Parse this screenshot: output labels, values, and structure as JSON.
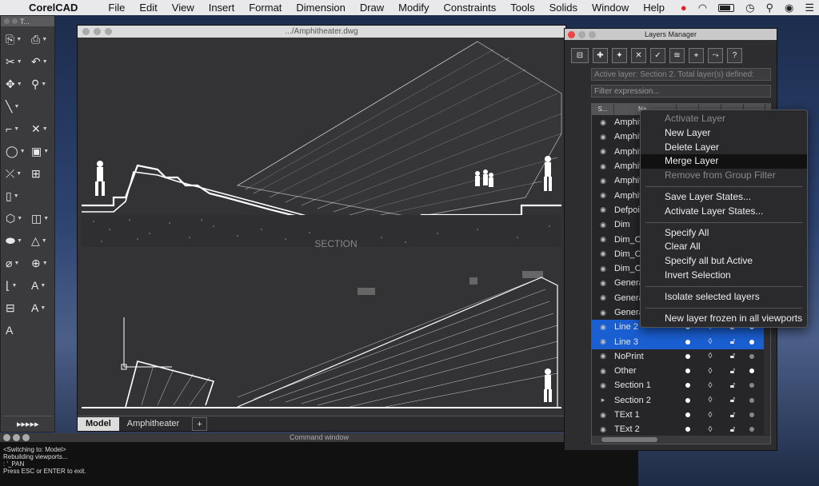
{
  "menubar": {
    "app_name": "CorelCAD",
    "items": [
      "File",
      "Edit",
      "View",
      "Insert",
      "Format",
      "Dimension",
      "Draw",
      "Modify",
      "Constraints",
      "Tools",
      "Solids",
      "Window",
      "Help"
    ]
  },
  "toolbox": {
    "title": "T...",
    "footer": "▸▸▸▸▸"
  },
  "drawing": {
    "title": ".../Amphitheater.dwg",
    "section_label": "SECTION",
    "tabs": [
      "Model",
      "Amphitheater",
      "+"
    ]
  },
  "command": {
    "title": "Command window",
    "lines": [
      "<Switching to: Model>",
      "Rebuilding viewports...",
      ": '_PAN",
      "Press ESC or ENTER to exit."
    ]
  },
  "layers": {
    "title": "Layers Manager",
    "active_text": "Active layer: Section 2. Total layer(s) defined:",
    "filter_placeholder": "Filter expression...",
    "headers": [
      "S...",
      "Na...",
      "",
      "",
      " ",
      ""
    ],
    "rows": [
      {
        "name": "Amphitheater"
      },
      {
        "name": "Amphitheater"
      },
      {
        "name": "Amphitheater"
      },
      {
        "name": "Amphitheater"
      },
      {
        "name": "Amphitheater"
      },
      {
        "name": "Amphitheater"
      },
      {
        "name": "Defpoints"
      },
      {
        "name": "Dim"
      },
      {
        "name": "Dim_Cont"
      },
      {
        "name": "Dim_Cont"
      },
      {
        "name": "Dim_Cont"
      },
      {
        "name": "General"
      },
      {
        "name": "General"
      },
      {
        "name": "General"
      },
      {
        "name": "Line 2"
      },
      {
        "name": "Line 3"
      },
      {
        "name": "NoPrint"
      },
      {
        "name": "Other"
      },
      {
        "name": "Section 1"
      },
      {
        "name": "Section 2"
      },
      {
        "name": "TExt 1"
      },
      {
        "name": "TExt 2"
      }
    ]
  },
  "context_menu": {
    "groups": [
      [
        {
          "label": "Activate Layer",
          "disabled": true
        },
        {
          "label": "New Layer"
        },
        {
          "label": "Delete Layer"
        },
        {
          "label": "Merge Layer",
          "highlight": true
        },
        {
          "label": "Remove from Group Filter",
          "disabled": true
        }
      ],
      [
        {
          "label": "Save Layer States..."
        },
        {
          "label": "Activate Layer States..."
        }
      ],
      [
        {
          "label": "Specify All"
        },
        {
          "label": "Clear All"
        },
        {
          "label": "Specify all but Active"
        },
        {
          "label": "Invert Selection"
        }
      ],
      [
        {
          "label": "Isolate selected layers"
        }
      ],
      [
        {
          "label": "New layer frozen in all viewports"
        }
      ]
    ]
  },
  "colors": {
    "selection": "#1a5fd2",
    "highlight": "#111111"
  }
}
